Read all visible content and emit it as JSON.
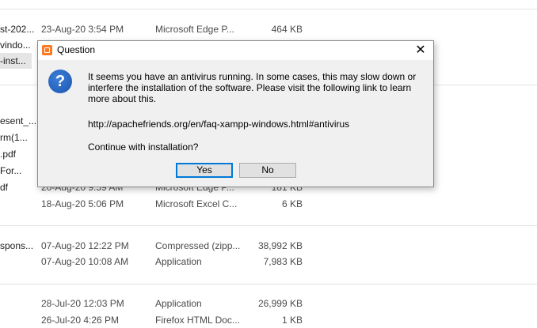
{
  "file_list": {
    "rows": [
      {
        "name": "st-202...",
        "date": "23-Aug-20 3:54 PM",
        "type": "Microsoft Edge P...",
        "size": "464 KB"
      },
      {
        "name": "vindo...",
        "date": "",
        "type": "",
        "size": ""
      },
      {
        "name": "-inst...",
        "date": "",
        "type": "",
        "size": ""
      },
      {
        "name": "esent_...",
        "date": "",
        "type": "",
        "size": ""
      },
      {
        "name": "rm(1...",
        "date": "",
        "type": "",
        "size": ""
      },
      {
        "name": ".pdf",
        "date": "",
        "type": "",
        "size": ""
      },
      {
        "name": "For...",
        "date": "",
        "type": "",
        "size": ""
      },
      {
        "name": "df",
        "date": "20-Aug-20 9:59 AM",
        "type": "Microsoft Edge P...",
        "size": "181 KB"
      },
      {
        "name": "",
        "date": "18-Aug-20 5:06 PM",
        "type": "Microsoft Excel C...",
        "size": "6 KB"
      },
      {
        "name": "spons...",
        "date": "07-Aug-20 12:22 PM",
        "type": "Compressed (zipp...",
        "size": "38,992 KB"
      },
      {
        "name": "",
        "date": "07-Aug-20 10:08 AM",
        "type": "Application",
        "size": "7,983 KB"
      },
      {
        "name": "",
        "date": "28-Jul-20 12:03 PM",
        "type": "Application",
        "size": "26,999 KB"
      },
      {
        "name": "",
        "date": "26-Jul-20 4:26 PM",
        "type": "Firefox HTML Doc...",
        "size": "1 KB"
      }
    ]
  },
  "dialog": {
    "title": "Question",
    "close_glyph": "✕",
    "icon_glyph": "?",
    "message": "It seems you have an antivirus running. In some cases, this may slow down or interfere the installation of the software. Please visit the following link to learn more about this.",
    "url": "http://apachefriends.org/en/faq-xampp-windows.html#antivirus",
    "prompt": "Continue with installation?",
    "yes_label": "Yes",
    "no_label": "No"
  },
  "colors": {
    "dialog_bg": "#f0f0f0",
    "default_button_border": "#0078d7",
    "question_icon": "#1b55b0",
    "app_icon": "#fb7a24"
  }
}
